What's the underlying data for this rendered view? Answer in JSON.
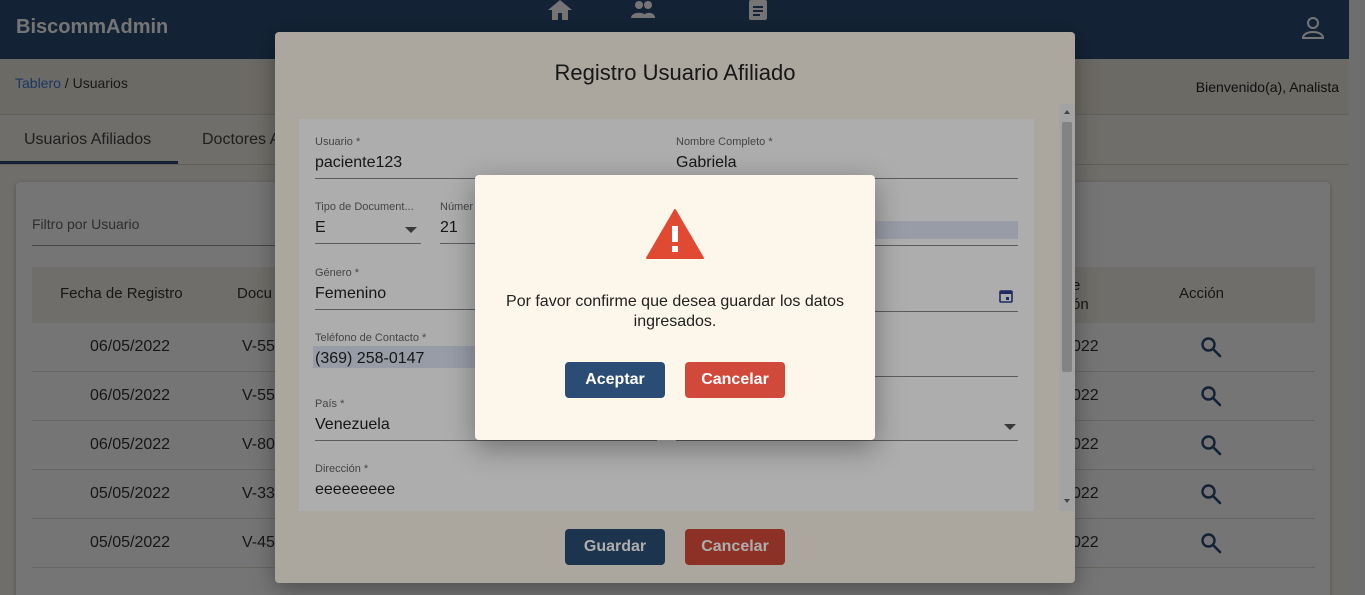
{
  "app": {
    "brand": "BiscommAdmin"
  },
  "nav": {
    "icons": [
      "home-icon",
      "people-icon",
      "clipboard-icon",
      "account-icon"
    ]
  },
  "breadcrumb": {
    "link": "Tablero",
    "separator": " / ",
    "current": "Usuarios"
  },
  "welcome": "Bienvenido(a), Analista",
  "tabs": [
    {
      "label": "Usuarios Afiliados"
    },
    {
      "label": "Doctores A"
    }
  ],
  "filter": {
    "label": "Filtro por Usuario"
  },
  "table": {
    "headers": {
      "fecha": "Fecha de Registro",
      "documento": "Docu",
      "fecha2_line1": "e",
      "fecha2_line2": "ón",
      "accion": "Acción"
    },
    "rows": [
      {
        "fecha": "06/05/2022",
        "doc": "V-55",
        "fecha2": "022"
      },
      {
        "fecha": "06/05/2022",
        "doc": "V-55",
        "fecha2": "022"
      },
      {
        "fecha": "06/05/2022",
        "doc": "V-80",
        "fecha2": "022"
      },
      {
        "fecha": "05/05/2022",
        "doc": "V-33",
        "fecha2": "022"
      },
      {
        "fecha": "05/05/2022",
        "doc": "V-45",
        "fecha2": "022"
      }
    ]
  },
  "modal": {
    "title": "Registro Usuario Afiliado",
    "fields": {
      "usuario": {
        "label": "Usuario *",
        "value": "paciente123"
      },
      "nombre": {
        "label": "Nombre Completo *",
        "value": "Gabriela"
      },
      "tipo_doc": {
        "label": "Tipo de Document...",
        "value": "E"
      },
      "numero": {
        "label": "Númer",
        "value": "21"
      },
      "genero": {
        "label": "Género *",
        "value": "Femenino"
      },
      "telefono": {
        "label": "Teléfono de Contacto *",
        "value": "(369) 258-0147"
      },
      "pais": {
        "label": "País *",
        "value": "Venezuela"
      },
      "direccion": {
        "label": "Dirección *",
        "value": "eeeeeeeee"
      }
    },
    "save_label": "Guardar",
    "cancel_label": "Cancelar"
  },
  "dialog": {
    "message": "Por favor confirme que desea guardar los datos ingresados.",
    "accept_label": "Aceptar",
    "cancel_label": "Cancelar"
  },
  "colors": {
    "primary": "#2b4d75",
    "danger": "#d0493a",
    "background": "#f4efe6",
    "dialog": "#fdf6ea",
    "warning": "#e04a32"
  }
}
